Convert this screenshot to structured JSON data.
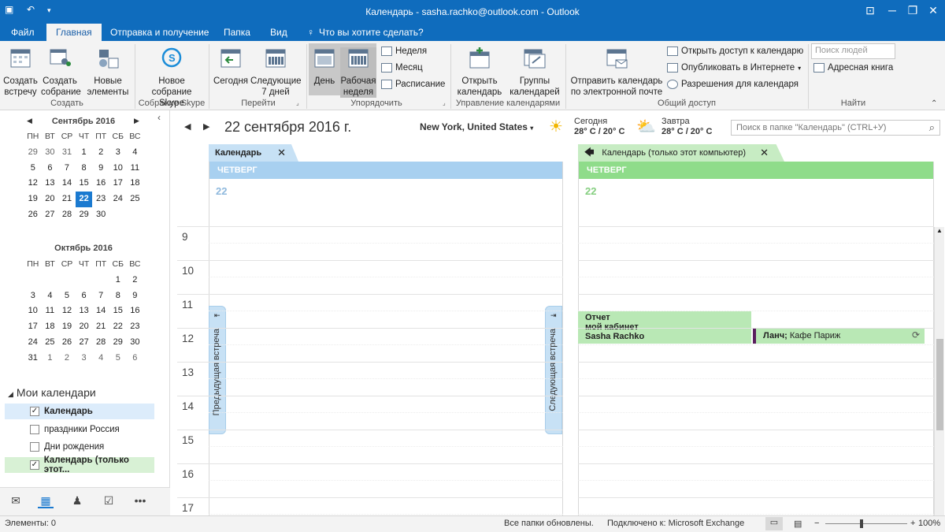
{
  "window": {
    "title": "Календарь - sasha.rachko@outlook.com - Outlook"
  },
  "tabs": [
    "Файл",
    "Главная",
    "Отправка и получение",
    "Папка",
    "Вид"
  ],
  "tell_me": "Что вы хотите сделать?",
  "ribbon": {
    "create": {
      "label": "Создать",
      "new_meeting": "Создать встречу",
      "new_meeting_2": "Создать собрание",
      "new_items": "Новые элементы"
    },
    "skype": {
      "label": "Собрание Skype",
      "new_skype": "Новое собрание Skype"
    },
    "go": {
      "label": "Перейти",
      "today": "Сегодня",
      "next7": "Следующие 7 дней"
    },
    "arrange": {
      "label": "Упорядочить",
      "day": "День",
      "workweek": "Рабочая неделя",
      "week": "Неделя",
      "month": "Месяц",
      "schedule": "Расписание"
    },
    "manage": {
      "label": "Управление календарями",
      "open": "Открыть календарь",
      "groups": "Группы календарей"
    },
    "share": {
      "label": "Общий доступ",
      "email": "Отправить календарь по электронной почте",
      "share": "Открыть доступ к календарю",
      "publish": "Опубликовать в Интернете",
      "permissions": "Разрешения для календаря"
    },
    "find": {
      "label": "Найти",
      "search_people": "Поиск людей",
      "address_book": "Адресная книга"
    }
  },
  "minical": {
    "sep": {
      "title": "Сентябрь 2016",
      "dows": [
        "ПН",
        "ВТ",
        "СР",
        "ЧТ",
        "ПТ",
        "СБ",
        "ВС"
      ],
      "weeks": [
        [
          "29",
          "30",
          "31",
          "1",
          "2",
          "3",
          "4"
        ],
        [
          "5",
          "6",
          "7",
          "8",
          "9",
          "10",
          "11"
        ],
        [
          "12",
          "13",
          "14",
          "15",
          "16",
          "17",
          "18"
        ],
        [
          "19",
          "20",
          "21",
          "22",
          "23",
          "24",
          "25"
        ],
        [
          "26",
          "27",
          "28",
          "29",
          "30",
          "",
          ""
        ]
      ],
      "selected": "22"
    },
    "oct": {
      "title": "Октябрь 2016",
      "dows": [
        "ПН",
        "ВТ",
        "СР",
        "ЧТ",
        "ПТ",
        "СБ",
        "ВС"
      ],
      "weeks": [
        [
          "",
          "",
          "",
          "",
          "",
          "1",
          "2"
        ],
        [
          "3",
          "4",
          "5",
          "6",
          "7",
          "8",
          "9"
        ],
        [
          "10",
          "11",
          "12",
          "13",
          "14",
          "15",
          "16"
        ],
        [
          "17",
          "18",
          "19",
          "20",
          "21",
          "22",
          "23"
        ],
        [
          "24",
          "25",
          "26",
          "27",
          "28",
          "29",
          "30"
        ],
        [
          "31",
          "1",
          "2",
          "3",
          "4",
          "5",
          "6"
        ]
      ]
    }
  },
  "my_calendars": {
    "title": "Мои календари",
    "items": [
      {
        "label": "Календарь",
        "checked": true
      },
      {
        "label": "праздники Россия",
        "checked": false
      },
      {
        "label": "Дни рождения",
        "checked": false
      },
      {
        "label": "Календарь (только этот...",
        "checked": true
      }
    ]
  },
  "header": {
    "date": "22 сентября 2016 г.",
    "location": "New York, United States",
    "today_label": "Сегодня",
    "today_temp": "28° C / 20° C",
    "tomorrow_label": "Завтра",
    "tomorrow_temp": "28° C / 20° C",
    "search_placeholder": "Поиск в папке \"Календарь\" (CTRL+У)"
  },
  "panes": [
    {
      "tab": "Календарь",
      "day": "ЧЕТВЕРГ",
      "daynum": "22",
      "color": "#a8d0f0"
    },
    {
      "tab": "Календарь (только этот компьютер)",
      "day": "ЧЕТВЕРГ",
      "daynum": "22",
      "color": "#8fdc8a"
    }
  ],
  "hours": [
    "9",
    "10",
    "11",
    "12",
    "13",
    "14",
    "15",
    "16",
    "17"
  ],
  "prev_appt": "Предыдущая встреча",
  "next_appt": "Следующая встреча",
  "events": {
    "report": {
      "title": "Отчет",
      "location": "мой кабинет",
      "organizer": "Sasha Rachko"
    },
    "lunch": {
      "title": "Ланч;",
      "location": "Кафе Париж"
    }
  },
  "status": {
    "items": "Элементы: 0",
    "updated": "Все папки обновлены.",
    "connected": "Подключено к: Microsoft Exchange",
    "zoom": "100%"
  },
  "colors": {
    "accent": "#0f6cbd",
    "pane1": "#a8d0f0",
    "pane2": "#8fdc8a",
    "event": "#b9e8b5"
  }
}
